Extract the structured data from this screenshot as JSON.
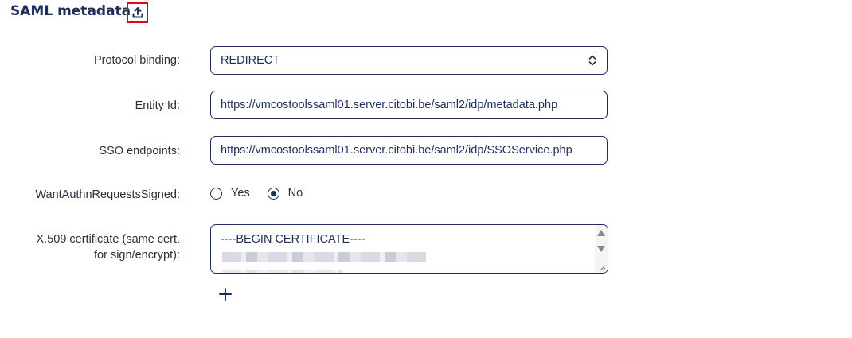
{
  "section": {
    "title": "SAML metadata",
    "upload_icon": "upload-icon"
  },
  "form": {
    "protocol_binding": {
      "label": "Protocol binding:",
      "value": "REDIRECT",
      "icon": "select-chevron-icon"
    },
    "entity_id": {
      "label": "Entity Id:",
      "value": "https://vmcostoolssaml01.server.citobi.be/saml2/idp/metadata.php"
    },
    "sso_endpoints": {
      "label": "SSO endpoints:",
      "value": "https://vmcostoolssaml01.server.citobi.be/saml2/idp/SSOService.php"
    },
    "want_authn": {
      "label": "WantAuthnRequestsSigned:",
      "options": [
        {
          "label": "Yes",
          "selected": false
        },
        {
          "label": "No",
          "selected": true
        }
      ]
    },
    "certificate": {
      "label_line1": "X.509 certificate (same cert.",
      "label_line2": "for sign/encrypt):",
      "value": "----BEGIN CERTIFICATE----"
    },
    "add_icon": "plus-icon"
  },
  "colors": {
    "accent": "#1f2d5a",
    "highlight": "#e30613"
  }
}
